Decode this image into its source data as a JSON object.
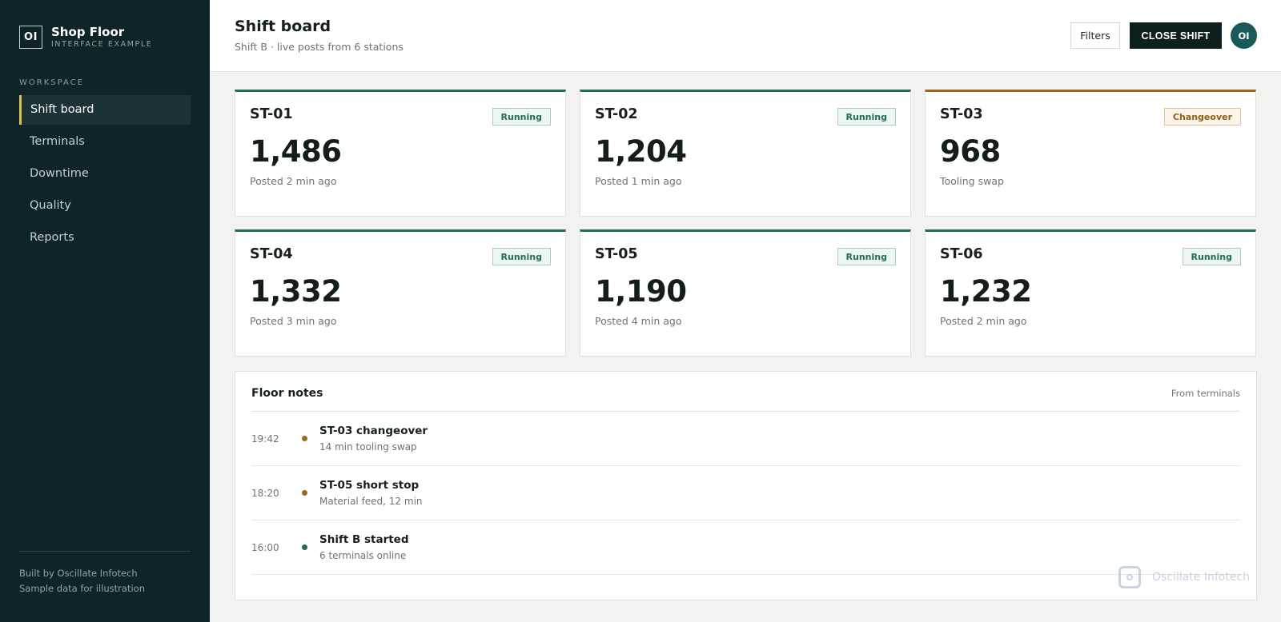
{
  "brand": {
    "logo": "OI",
    "name": "Shop Floor",
    "sub": "INTERFACE EXAMPLE"
  },
  "sidebar": {
    "section": "WORKSPACE",
    "items": [
      {
        "label": "Shift board"
      },
      {
        "label": "Terminals"
      },
      {
        "label": "Downtime"
      },
      {
        "label": "Quality"
      },
      {
        "label": "Reports"
      }
    ],
    "footer_line1": "Built by Oscillate Infotech",
    "footer_line2": "Sample data for illustration"
  },
  "header": {
    "title": "Shift board",
    "subtitle": "Shift B · live posts from 6 stations",
    "filters_label": "Filters",
    "close_label": "CLOSE SHIFT",
    "avatar": "OI"
  },
  "stations": [
    {
      "id": "ST-01",
      "status": "Running",
      "value": "1,486",
      "note": "Posted 2 min ago"
    },
    {
      "id": "ST-02",
      "status": "Running",
      "value": "1,204",
      "note": "Posted 1 min ago"
    },
    {
      "id": "ST-03",
      "status": "Changeover",
      "value": "968",
      "note": "Tooling swap"
    },
    {
      "id": "ST-04",
      "status": "Running",
      "value": "1,332",
      "note": "Posted 3 min ago"
    },
    {
      "id": "ST-05",
      "status": "Running",
      "value": "1,190",
      "note": "Posted 4 min ago"
    },
    {
      "id": "ST-06",
      "status": "Running",
      "value": "1,232",
      "note": "Posted 2 min ago"
    }
  ],
  "notes": {
    "title": "Floor notes",
    "source": "From terminals",
    "items": [
      {
        "time": "19:42",
        "title": "ST-03 changeover",
        "sub": "14 min tooling swap"
      },
      {
        "time": "18:20",
        "title": "ST-05 short stop",
        "sub": "Material feed, 12 min"
      },
      {
        "time": "16:00",
        "title": "Shift B started",
        "sub": "6 terminals online"
      }
    ]
  },
  "watermark": {
    "text": "Oscillate Infotech"
  },
  "colors": {
    "sidebar": "#0e2426",
    "running": "#1f6e55",
    "changeover": "#9a6a1a",
    "active_accent": "#e2bf4a"
  }
}
